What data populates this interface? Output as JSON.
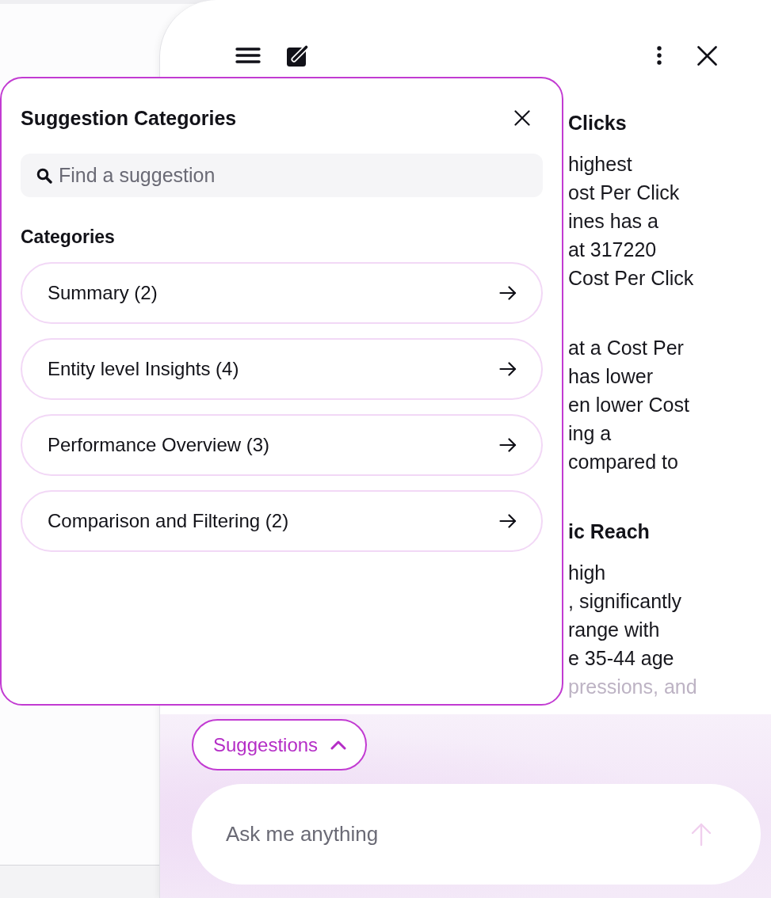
{
  "chat_panel": {
    "message": {
      "sections": [
        {
          "heading": "Clicks",
          "paragraphs": [
            [
              "highest",
              "ost Per Click",
              "ines has a",
              "at 317220",
              "Cost Per Click"
            ],
            [
              "at a Cost Per",
              "has lower",
              "en lower Cost",
              "ing a",
              "compared to"
            ]
          ]
        },
        {
          "heading": "ic Reach",
          "paragraphs": [
            [
              "high",
              ", significantly",
              "range with",
              "e 35-44 age",
              "pressions, and"
            ]
          ]
        }
      ]
    },
    "composer": {
      "suggestions_button": {
        "label": "Suggestions",
        "expanded": true
      },
      "input": {
        "placeholder": "Ask me anything"
      },
      "send_button": {
        "disabled": true
      }
    }
  },
  "suggestion_popup": {
    "title": "Suggestion Categories",
    "search": {
      "placeholder": "Find a suggestion"
    },
    "section_label": "Categories",
    "categories": [
      {
        "label": "Summary (2)"
      },
      {
        "label": "Entity level Insights (4)"
      },
      {
        "label": "Performance Overview (3)"
      },
      {
        "label": "Comparison and Filtering (2)"
      }
    ]
  }
}
